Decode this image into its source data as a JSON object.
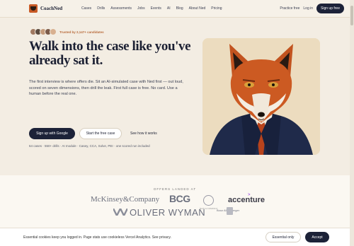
{
  "nav": {
    "brand": "CoachNed",
    "links": [
      "Cases",
      "Drills",
      "Assessments",
      "Jobs",
      "Events",
      "AI",
      "Blog",
      "About Ned",
      "Pricing"
    ],
    "practice": "Practice free",
    "login": "Log in",
    "signup": "Sign up free"
  },
  "hero": {
    "trusted": "Trusted by 2,147+ candidates",
    "headline": "Walk into the case like you've already sat it.",
    "sub": "The first interview is where offers die. Sit an AI-simulated case with Ned first — out loud, scored on seven dimensions, then drill the leak. First full case is free. No card. Use a human before the real one.",
    "btn_google": "Sign up with Google",
    "btn_free": "Start the free case",
    "btn_how": "See how it works",
    "meta": "64 cases · 550+ drills · AI module · Casey, CCA, Solve, PEI · one scored run included"
  },
  "offers": {
    "label": "OFFERS LANDED AT",
    "firms": [
      "McKinsey&Company",
      "BCG",
      "accenture",
      "OLIVER WYMAN"
    ],
    "bain_caption": "BAIN & COMPANY",
    "kearney_caption": "Booz Allen Berger"
  },
  "cookie": {
    "text": "Essential cookies keep you logged in. Page stats use cookieless Vercel Analytics. See privacy.",
    "btn_essential": "Essential only",
    "btn_accept": "Accept"
  },
  "colors": {
    "navy": "#1c2238",
    "accent": "#b86a3a",
    "hero_bg": "#f3ede3"
  }
}
